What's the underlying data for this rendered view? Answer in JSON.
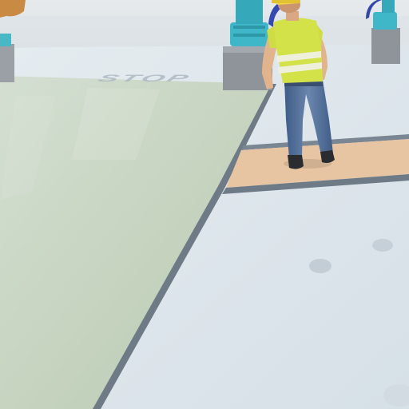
{
  "scene": {
    "kind": "3d-render",
    "subject": "worker",
    "floor_marking_text": "STOP",
    "colors": {
      "green_walkway": "#c9d6c4",
      "pale_floor": "#dfe7ec",
      "sky_wall": "#d8dee3",
      "orange_zone": "#e8c4a2",
      "stripe_dark": "#6d7a86",
      "vest_yellow": "#d6e34a",
      "reflective_stripe": "#eef0d9",
      "jeans_blue": "#4d6a95",
      "helmet_yellow": "#f2d640",
      "machine_teal": "#3fb8c9",
      "machine_base": "#8a8f93"
    }
  }
}
